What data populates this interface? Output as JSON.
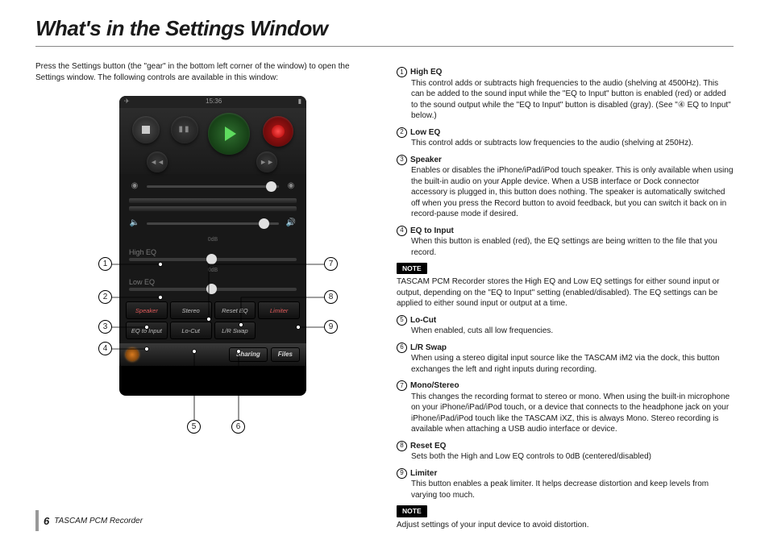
{
  "page": {
    "title": "What's in the Settings Window",
    "intro": "Press the Settings button (the \"gear\" in the bottom left corner of the window) to open the Settings window. The following controls are available in this window:",
    "footer_text": "TASCAM PCM Recorder",
    "page_number": "6"
  },
  "phone": {
    "time": "15:36",
    "high_eq_label": "High EQ",
    "low_eq_label": "Low EQ",
    "db_label": "0dB",
    "buttons": {
      "speaker": "Speaker",
      "stereo": "Stereo",
      "reset_eq": "Reset EQ",
      "limiter": "Limiter",
      "eq_to_input": "EQ to Input",
      "lo_cut": "Lo-Cut",
      "lr_swap": "L/R Swap",
      "sharing": "Sharing",
      "files": "Files"
    }
  },
  "callouts": {
    "left": [
      "1",
      "2",
      "3",
      "4"
    ],
    "right": [
      "7",
      "8",
      "9"
    ],
    "bottom": [
      "5",
      "6"
    ]
  },
  "items": [
    {
      "num": "1",
      "title": "High EQ",
      "body": "This control adds or subtracts high frequencies to the audio (shelving at 4500Hz). This can be added to the sound input while the \"EQ to Input\" button is enabled (red) or added to the sound output while the \"EQ to Input\" button is disabled (gray). (See \"④ EQ to Input\" below.)"
    },
    {
      "num": "2",
      "title": "Low EQ",
      "body": "This control adds or subtracts low frequencies to the audio (shelving at 250Hz)."
    },
    {
      "num": "3",
      "title": "Speaker",
      "body": "Enables or disables the iPhone/iPad/iPod touch speaker. This is only available when using the built-in audio on your Apple device. When a USB interface or Dock connector accessory is plugged in, this button does nothing. The speaker is automatically switched off when you press the Record button to avoid feedback, but you can switch it back on in record-pause mode if desired."
    },
    {
      "num": "4",
      "title": "EQ to Input",
      "body": "When this button is enabled (red), the EQ settings are being written to the file that you record."
    },
    {
      "num": "5",
      "title": "Lo-Cut",
      "body": "When enabled, cuts all low frequencies."
    },
    {
      "num": "6",
      "title": "L/R Swap",
      "body": "When using a stereo digital input source like the TASCAM iM2 via the dock, this button exchanges the left and right inputs during recording."
    },
    {
      "num": "7",
      "title": " Mono/Stereo",
      "body": "This changes the recording format to stereo or mono. When using the built-in microphone on your iPhone/iPad/iPod touch, or a device that connects to the headphone jack on your iPhone/iPad/iPod touch like the TASCAM iXZ, this is always Mono. Stereo recording is available when attaching a USB audio interface or device."
    },
    {
      "num": "8",
      "title": "Reset EQ",
      "body": "Sets both the High and Low EQ controls to 0dB (centered/disabled)"
    },
    {
      "num": "9",
      "title": "Limiter",
      "body": "This button enables a peak limiter. It helps decrease distortion and keep levels from varying too much."
    }
  ],
  "notes": [
    {
      "after": "4",
      "label": "NOTE",
      "text": "TASCAM PCM Recorder stores the High EQ and Low EQ settings for either sound input or output, depending on the \"EQ to Input\" setting (enabled/disabled). The EQ settings can be applied to either sound input or output at a time."
    },
    {
      "after": "9",
      "label": "NOTE",
      "text": "Adjust settings of your input device to avoid distortion."
    }
  ]
}
